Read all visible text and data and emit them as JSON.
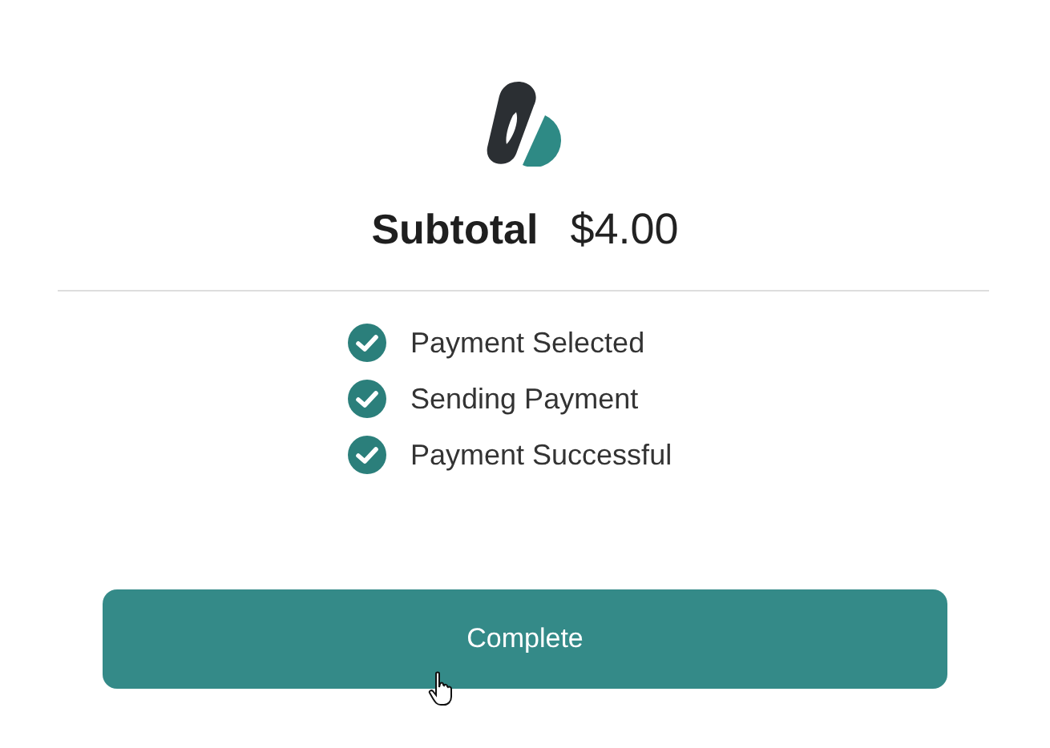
{
  "summary": {
    "label": "Subtotal",
    "amount": "$4.00"
  },
  "steps": [
    {
      "label": "Payment Selected",
      "checked": true
    },
    {
      "label": "Sending Payment",
      "checked": true
    },
    {
      "label": "Payment Successful",
      "checked": true
    }
  ],
  "button": {
    "label": "Complete"
  }
}
